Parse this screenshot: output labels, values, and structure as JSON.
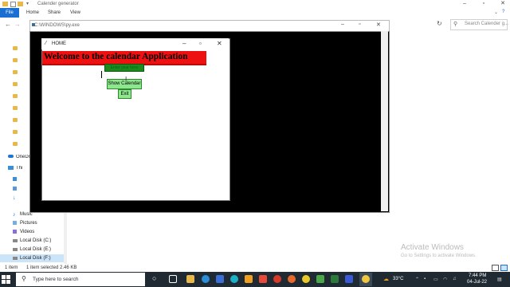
{
  "explorer": {
    "title": "Calender generator",
    "ribbon_tabs": [
      "File",
      "Home",
      "Share",
      "View"
    ],
    "search_placeholder": "Search Calender g...",
    "nav_items": [
      "OneDrive",
      "This PC",
      "Music",
      "Pictures",
      "Videos",
      "Local Disk (C:)",
      "Local Disk (E:)",
      "Local Disk (F:)"
    ],
    "status_left": "1 item",
    "status_selected": "1 item selected  2.46 KB"
  },
  "cmd": {
    "title": "C:\\WINDOWS\\py.exe"
  },
  "tk_window": {
    "title": "HOME",
    "welcome": "Welcome to the calendar Application",
    "year_label": "Enter year here",
    "show_button": "Show Calendar",
    "exit_button": "Exit"
  },
  "watermark": {
    "line1": "Activate Windows",
    "line2": "Go to Settings to activate Windows."
  },
  "taskbar": {
    "search_placeholder": "Type here to search",
    "weather": "33°C",
    "time": "7:44 PM",
    "date": "04-Jul-22"
  },
  "colors": {
    "banner": "#ee1111",
    "button": "#8ee68e",
    "label_bg": "#1c8a1c",
    "taskbar": "#1f2a33",
    "file_tab": "#1a6fd1"
  }
}
